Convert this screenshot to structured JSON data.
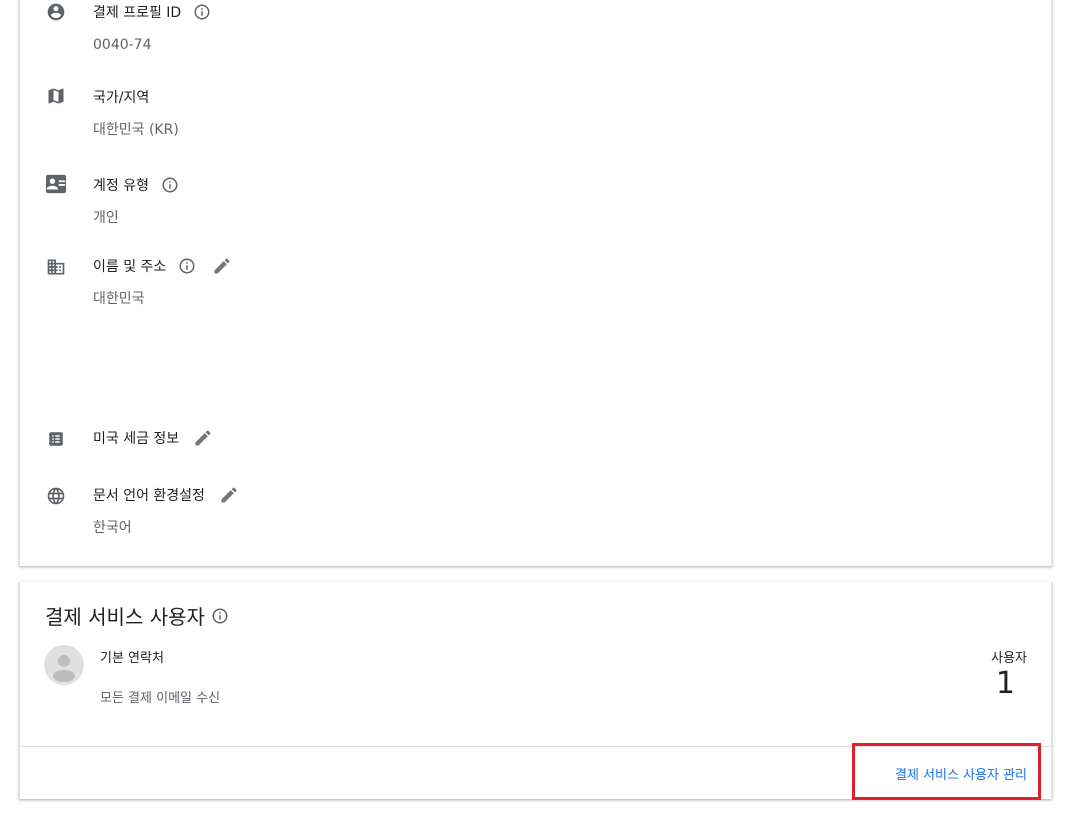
{
  "profile": {
    "payment_profile_id": {
      "label": "결제 프로필 ID",
      "value": "0040-74"
    },
    "country": {
      "label": "국가/지역",
      "value": "대한민국 (KR)"
    },
    "account_type": {
      "label": "계정 유형",
      "value": "개인"
    },
    "name_address": {
      "label": "이름 및 주소",
      "value": "대한민국"
    },
    "us_tax": {
      "label": "미국 세금 정보"
    },
    "doc_language": {
      "label": "문서 언어 환경설정",
      "value": "한국어"
    }
  },
  "payment_users": {
    "title": "결제 서비스 사용자",
    "contact_name": "기본 연락처",
    "contact_desc": "모든 결제 이메일 수신",
    "users_label": "사용자",
    "users_count": "1",
    "manage_link": "결제 서비스 사용자 관리"
  },
  "colors": {
    "link": "#1a73e8",
    "icon": "#5f6368",
    "highlight": "#e0202e"
  }
}
